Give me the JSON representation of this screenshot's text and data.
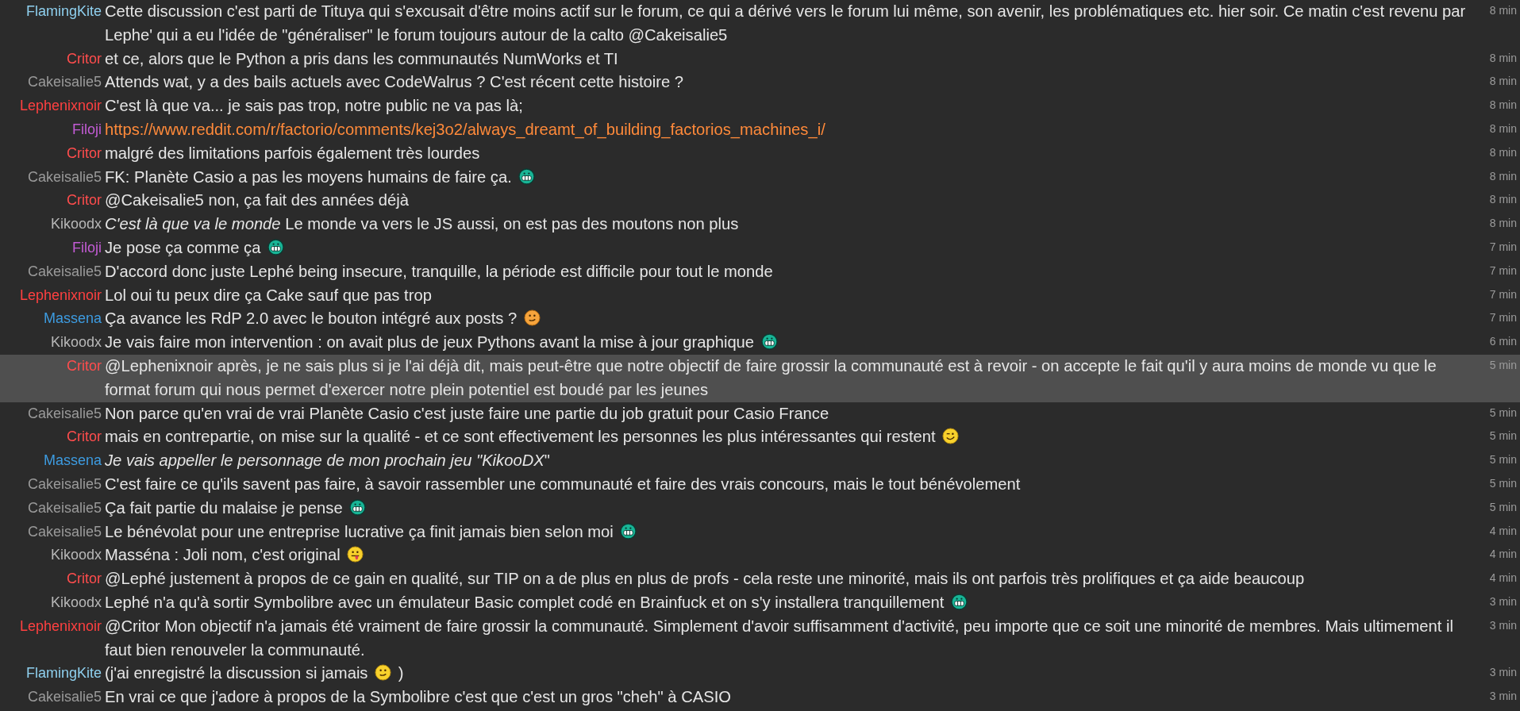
{
  "messages": [
    {
      "author": "FlamingKite",
      "color": "#8fd0ef",
      "highlighted": false,
      "time": "8 min",
      "parts": [
        {
          "kind": "text",
          "text": "Cette discussion c'est parti de Tituya qui s'excusait d'être moins actif sur le forum, ce qui a dérivé vers le forum lui même, son avenir, les problématiques etc. hier soir. Ce matin c'est revenu par Lephe' qui a eu l'idée de \"généraliser\" le forum toujours autour de la calto @Cakeisalie5"
        }
      ]
    },
    {
      "author": "Critor",
      "color": "#ff4d4d",
      "highlighted": false,
      "time": "8 min",
      "parts": [
        {
          "kind": "text",
          "text": "et ce, alors que le Python a pris dans les communautés NumWorks et TI"
        }
      ]
    },
    {
      "author": "Cakeisalie5",
      "color": "#9a9a9a",
      "highlighted": false,
      "time": "8 min",
      "parts": [
        {
          "kind": "text",
          "text": "Attends wat, y a des bails actuels avec CodeWalrus ? C'est récent cette histoire ?"
        }
      ]
    },
    {
      "author": "Lephenixnoir",
      "color": "#ff4040",
      "highlighted": false,
      "time": "8 min",
      "parts": [
        {
          "kind": "text",
          "text": "C'est là que va... je sais pas trop, notre public ne va pas là;"
        }
      ]
    },
    {
      "author": "Filoji",
      "color": "#c45cd6",
      "highlighted": false,
      "time": "8 min",
      "parts": [
        {
          "kind": "link",
          "text": "https://www.reddit.com/r/factorio/comments/kej3o2/always_dreamt_of_building_factorios_machines_i/"
        }
      ]
    },
    {
      "author": "Critor",
      "color": "#ff4d4d",
      "highlighted": false,
      "time": "8 min",
      "parts": [
        {
          "kind": "text",
          "text": "malgré des limitations parfois également très lourdes"
        }
      ]
    },
    {
      "author": "Cakeisalie5",
      "color": "#9a9a9a",
      "highlighted": false,
      "time": "8 min",
      "parts": [
        {
          "kind": "text",
          "text": "FK: Planète Casio a pas les moyens humains de faire ça."
        },
        {
          "kind": "grin"
        }
      ]
    },
    {
      "author": "Critor",
      "color": "#ff4d4d",
      "highlighted": false,
      "time": "8 min",
      "parts": [
        {
          "kind": "text",
          "text": "@Cakeisalie5 non, ça fait des années déjà"
        }
      ]
    },
    {
      "author": "Kikoodx",
      "color": "#b8b8b8",
      "highlighted": false,
      "time": "8 min",
      "parts": [
        {
          "kind": "text",
          "text": "*C'est là que va le monde* Le monde va vers le JS aussi, on est pas des moutons non plus"
        }
      ]
    },
    {
      "author": "Filoji",
      "color": "#c45cd6",
      "highlighted": false,
      "time": "7 min",
      "parts": [
        {
          "kind": "text",
          "text": "Je pose ça comme ça"
        },
        {
          "kind": "grin"
        }
      ]
    },
    {
      "author": "Cakeisalie5",
      "color": "#9a9a9a",
      "highlighted": false,
      "time": "7 min",
      "parts": [
        {
          "kind": "text",
          "text": "D'accord donc juste Lephé being insecure, tranquille, la période est difficile pour tout le monde"
        }
      ]
    },
    {
      "author": "Lephenixnoir",
      "color": "#ff4040",
      "highlighted": false,
      "time": "7 min",
      "parts": [
        {
          "kind": "text",
          "text": "Lol oui tu peux dire ça Cake sauf que pas trop"
        }
      ]
    },
    {
      "author": "Massena",
      "color": "#3d9be0",
      "highlighted": false,
      "time": "7 min",
      "parts": [
        {
          "kind": "text",
          "text": "Ça avance les RdP 2.0 avec le bouton intégré aux posts ?"
        },
        {
          "kind": "smile"
        }
      ]
    },
    {
      "author": "Kikoodx",
      "color": "#b8b8b8",
      "highlighted": false,
      "time": "6 min",
      "parts": [
        {
          "kind": "text",
          "text": "Je vais faire mon intervention : on avait plus de jeux Pythons avant la mise à jour graphique"
        },
        {
          "kind": "grin"
        }
      ]
    },
    {
      "author": "Critor",
      "color": "#ff4d4d",
      "highlighted": true,
      "time": "5 min",
      "parts": [
        {
          "kind": "text",
          "text": "@Lephenixnoir après, je ne sais plus si je l'ai déjà dit, mais peut-être que notre objectif de faire grossir la communauté est à revoir - on accepte le fait qu'il y aura moins de monde vu que le format forum qui nous permet d'exercer notre plein potentiel est boudé par les jeunes"
        }
      ]
    },
    {
      "author": "Cakeisalie5",
      "color": "#9a9a9a",
      "highlighted": false,
      "time": "5 min",
      "parts": [
        {
          "kind": "text",
          "text": "Non parce qu'en vrai de vrai Planète Casio c'est juste faire une partie du job gratuit pour Casio France"
        }
      ]
    },
    {
      "author": "Critor",
      "color": "#ff4d4d",
      "highlighted": false,
      "time": "5 min",
      "parts": [
        {
          "kind": "text",
          "text": "mais en contrepartie, on mise sur la qualité - et ce sont effectivement les personnes les plus intéressantes qui restent"
        },
        {
          "kind": "wink"
        }
      ]
    },
    {
      "author": "Massena",
      "color": "#3d9be0",
      "highlighted": false,
      "time": "5 min",
      "parts": [
        {
          "kind": "text",
          "text": "*Je vais appeller le personnage de mon prochain jeu \"KikooDX*\""
        }
      ]
    },
    {
      "author": "Cakeisalie5",
      "color": "#9a9a9a",
      "highlighted": false,
      "time": "5 min",
      "parts": [
        {
          "kind": "text",
          "text": "C'est faire ce qu'ils savent pas faire, à savoir rassembler une communauté et faire des vrais concours, mais le tout bénévolement"
        }
      ]
    },
    {
      "author": "Cakeisalie5",
      "color": "#9a9a9a",
      "highlighted": false,
      "time": "5 min",
      "parts": [
        {
          "kind": "text",
          "text": "Ça fait partie du malaise je pense"
        },
        {
          "kind": "grin"
        }
      ]
    },
    {
      "author": "Cakeisalie5",
      "color": "#9a9a9a",
      "highlighted": false,
      "time": "4 min",
      "parts": [
        {
          "kind": "text",
          "text": "Le bénévolat pour une entreprise lucrative ça finit jamais bien selon moi"
        },
        {
          "kind": "grin"
        }
      ]
    },
    {
      "author": "Kikoodx",
      "color": "#b8b8b8",
      "highlighted": false,
      "time": "4 min",
      "parts": [
        {
          "kind": "text",
          "text": "Masséna : Joli nom, c'est original"
        },
        {
          "kind": "tongue"
        }
      ]
    },
    {
      "author": "Critor",
      "color": "#ff4d4d",
      "highlighted": false,
      "time": "4 min",
      "parts": [
        {
          "kind": "text",
          "text": "@Lephé justement à propos de ce gain en qualité, sur TIP on a de plus en plus de profs - cela reste une minorité, mais ils ont parfois très prolifiques et ça aide beaucoup"
        }
      ]
    },
    {
      "author": "Kikoodx",
      "color": "#b8b8b8",
      "highlighted": false,
      "time": "3 min",
      "parts": [
        {
          "kind": "text",
          "text": "Lephé n'a qu'à sortir Symbolibre avec un émulateur Basic complet codé en Brainfuck et on s'y installera tranquillement"
        },
        {
          "kind": "grin"
        }
      ]
    },
    {
      "author": "Lephenixnoir",
      "color": "#ff4040",
      "highlighted": false,
      "time": "3 min",
      "parts": [
        {
          "kind": "text",
          "text": "@Critor Mon objectif n'a jamais été vraiment de faire grossir la communauté. Simplement d'avoir suffisamment d'activité, peu importe que ce soit une minorité de membres. Mais ultimement il faut bien renouveler la communauté."
        }
      ]
    },
    {
      "author": "FlamingKite",
      "color": "#8fd0ef",
      "highlighted": false,
      "time": "3 min",
      "parts": [
        {
          "kind": "text",
          "text": "(j'ai enregistré la discussion si jamais"
        },
        {
          "kind": "smile-yellow"
        },
        {
          "kind": "text",
          "text": ")"
        }
      ]
    },
    {
      "author": "Cakeisalie5",
      "color": "#9a9a9a",
      "highlighted": false,
      "time": "3 min",
      "parts": [
        {
          "kind": "text",
          "text": "En vrai ce que j'adore à propos de la Symbolibre c'est que c'est un gros \"cheh\" à CASIO"
        }
      ]
    }
  ]
}
